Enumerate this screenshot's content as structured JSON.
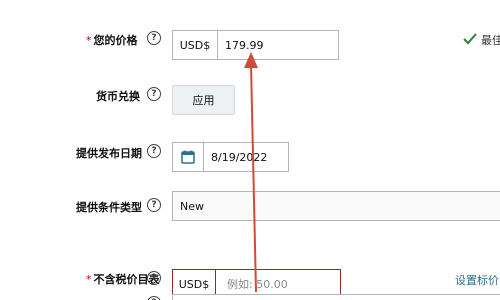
{
  "price": {
    "label": "您的价格",
    "currency": "USD$",
    "value": "179.99"
  },
  "status": {
    "text": "最佳"
  },
  "currency_conversion": {
    "label": "货币兑换",
    "apply_label": "应用"
  },
  "release_date": {
    "label": "提供发布日期",
    "value": "8/19/2022"
  },
  "condition": {
    "label": "提供条件类型",
    "value": "New"
  },
  "list_price": {
    "label": "不含税价目表",
    "currency": "USD$",
    "placeholder": "例如: 50.00",
    "link_text": "设置标价"
  },
  "colors": {
    "arrow": "#d04a3a",
    "error_border": "#8b2b2b",
    "link": "#2f6f8f",
    "check": "#2e7d32"
  }
}
